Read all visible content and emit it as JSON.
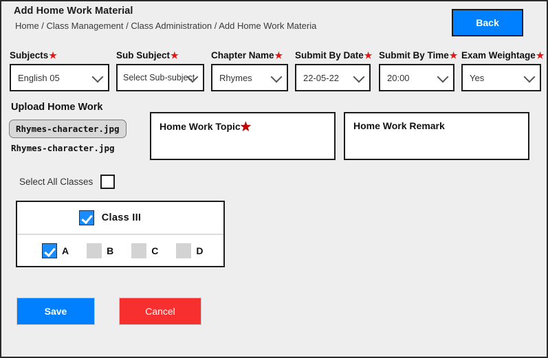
{
  "header": {
    "title": "Add Home Work Material",
    "breadcrumb": "Home / Class Management / Class Administration / Add Home Work Materia",
    "back_label": "Back"
  },
  "fields": [
    {
      "label": "Subjects",
      "required": true,
      "value": "English 05",
      "icon": "chevron-down-icon"
    },
    {
      "label": "Sub Subject",
      "required": true,
      "value": "Select Sub-subject",
      "icon": "chevron-down-icon"
    },
    {
      "label": "Chapter Name",
      "required": true,
      "value": "Rhymes",
      "icon": "chevron-down-icon"
    },
    {
      "label": "Submit By Date",
      "required": true,
      "value": "22-05-22",
      "icon": "chevron-down-icon"
    },
    {
      "label": "Submit By Time",
      "required": true,
      "value": "20:00",
      "icon": "chevron-down-icon"
    },
    {
      "label": "Exam Weightage",
      "required": true,
      "value": "Yes",
      "icon": "chevron-down-icon"
    }
  ],
  "upload": {
    "title": "Upload Home Work",
    "button_label": "Rhymes-character.jpg",
    "filename": "Rhymes-character.jpg"
  },
  "topic": {
    "label": "Home Work Topic",
    "star": "★",
    "value": ""
  },
  "remark": {
    "label": "Home Work Remark",
    "value": ""
  },
  "select_all": {
    "label": "Select All Classes",
    "checked": false
  },
  "class_panel": {
    "class_label": "Class III",
    "class_checked": true,
    "sections": [
      {
        "label": "A",
        "checked": true
      },
      {
        "label": "B",
        "checked": false
      },
      {
        "label": "C",
        "checked": false
      },
      {
        "label": "D",
        "checked": false
      }
    ]
  },
  "actions": {
    "save_label": "Save",
    "cancel_label": "Cancel"
  },
  "colors": {
    "accent_blue": "#0080ff",
    "danger_red": "#f72f2f",
    "required_star": "#e81313",
    "checkbox_blue": "#1a8cff",
    "checkbox_gray": "#d3d3d3",
    "page_bg": "#eeeeee"
  },
  "star_symbol": "★"
}
